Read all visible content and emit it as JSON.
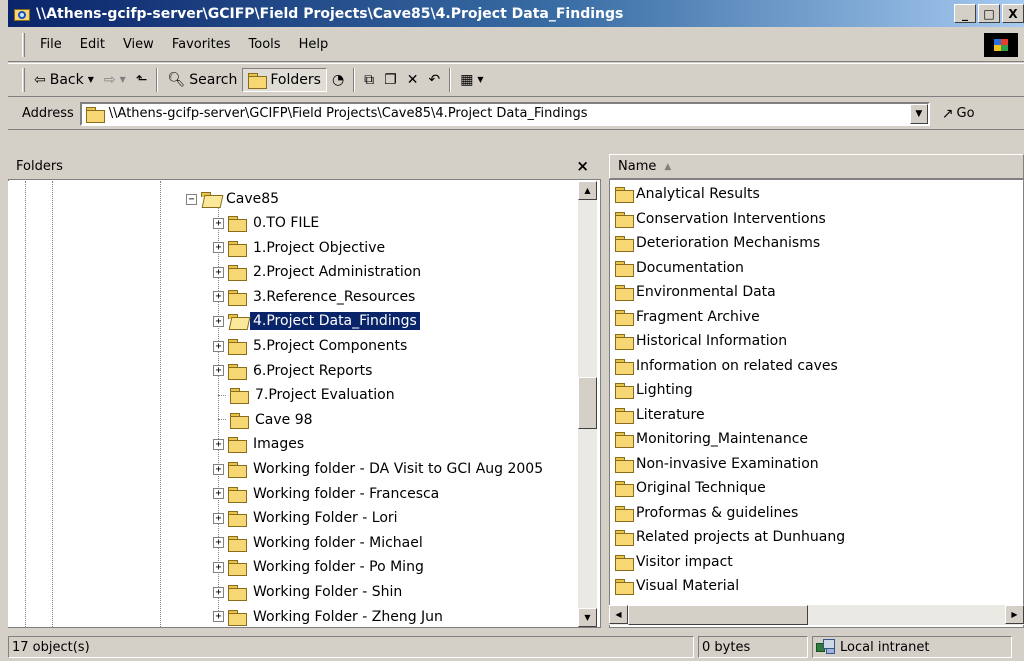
{
  "window": {
    "title": "\\\\Athens-gcifp-server\\GCIFP\\Field Projects\\Cave85\\4.Project Data_Findings",
    "controls": {
      "minimize": "_",
      "maximize": "□",
      "close": "X"
    }
  },
  "menu": {
    "items": [
      "File",
      "Edit",
      "View",
      "Favorites",
      "Tools",
      "Help"
    ]
  },
  "toolbar": {
    "back_label": "Back",
    "search_label": "Search",
    "folders_label": "Folders"
  },
  "address": {
    "label": "Address",
    "value": "\\\\Athens-gcifp-server\\GCIFP\\Field Projects\\Cave85\\4.Project Data_Findings",
    "go_label": "Go"
  },
  "folders_pane": {
    "title": "Folders",
    "close": "×",
    "root": "Cave85",
    "selected_index": 4,
    "items": [
      {
        "label": "0.TO FILE",
        "expandable": true
      },
      {
        "label": "1.Project Objective",
        "expandable": true
      },
      {
        "label": "2.Project Administration",
        "expandable": true
      },
      {
        "label": "3.Reference_Resources",
        "expandable": true
      },
      {
        "label": "4.Project Data_Findings",
        "expandable": true
      },
      {
        "label": "5.Project Components",
        "expandable": true
      },
      {
        "label": "6.Project Reports",
        "expandable": true
      },
      {
        "label": "7.Project Evaluation",
        "expandable": false
      },
      {
        "label": "Cave 98",
        "expandable": false
      },
      {
        "label": "Images",
        "expandable": true
      },
      {
        "label": "Working folder - DA Visit to GCI Aug 2005",
        "expandable": true
      },
      {
        "label": "Working folder - Francesca",
        "expandable": true
      },
      {
        "label": "Working Folder - Lori",
        "expandable": true
      },
      {
        "label": "Working folder - Michael",
        "expandable": true
      },
      {
        "label": "Working folder - Po Ming",
        "expandable": true
      },
      {
        "label": "Working Folder - Shin",
        "expandable": true
      },
      {
        "label": "Working Folder - Zheng Jun",
        "expandable": true
      }
    ]
  },
  "file_list": {
    "column_name": "Name",
    "items": [
      "Analytical Results",
      "Conservation Interventions",
      "Deterioration Mechanisms",
      "Documentation",
      "Environmental Data",
      "Fragment Archive",
      "Historical Information",
      "Information on related caves",
      "Lighting",
      "Literature",
      "Monitoring_Maintenance",
      "Non-invasive Examination",
      "Original Technique",
      "Proformas & guidelines",
      "Related projects at Dunhuang",
      "Visitor impact",
      "Visual Material"
    ]
  },
  "status": {
    "objects": "17 object(s)",
    "size": "0 bytes",
    "zone": "Local intranet"
  }
}
